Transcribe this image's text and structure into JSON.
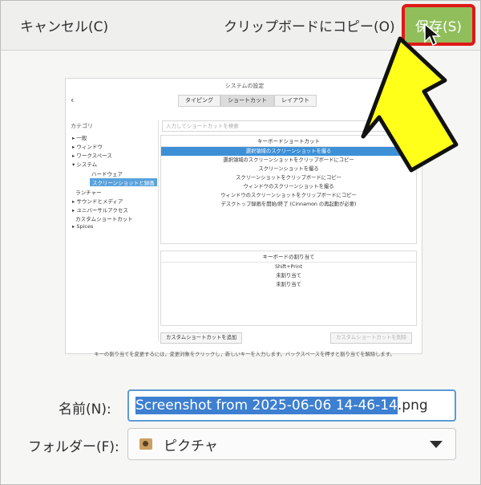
{
  "header": {
    "cancel_label": "キャンセル(C)",
    "copy_label": "クリップボードにコピー(O)",
    "save_label": "保存(S)"
  },
  "preview": {
    "window_title": "システムの設定",
    "tabs": [
      "タイピング",
      "ショートカット",
      "レイアウト"
    ],
    "sidebar_header": "カテゴリ",
    "sidebar_items": [
      "一般",
      "ウィンドウ",
      "ワークスペース",
      "システム",
      "ハードウェア",
      "スクリーンショットと録画",
      "ランチャー",
      "サウンドとメディア",
      "ユニバーサルアクセス",
      "カスタムショートカット",
      "Spices"
    ],
    "search_placeholder": "入力してショートカットを検索",
    "keyboard_shortcuts_header": "キーボードショートカット",
    "shortcuts": [
      "選択領域のスクリーンショットを撮る",
      "選択領域のスクリーンショットをクリップボードにコピー",
      "スクリーンショットを撮る",
      "スクリーンショットをクリップボードにコピー",
      "ウィンドウのスクリーンショットを撮る",
      "ウィンドウのスクリーンショットをクリップボードにコピー",
      "デスクトップ録画を開始/終了 (Cinnamon の再起動が必要)"
    ],
    "assignment_header": "キーボードの割り当て",
    "assignments": [
      "Shift+Print",
      "未割り当て",
      "未割り当て"
    ],
    "add_custom_button": "カスタムショートカットを追加",
    "remove_custom_button": "カスタムショートカットを削除",
    "footer_hint": "キーの割り当てを変更するには，変更対象をクリックし，新しいキーを入力します。バックスペースを押すと割り当てを解除します。"
  },
  "form": {
    "name_label": "名前(N):",
    "name_value_selected": "Screenshot from 2025-06-06 14-46-14",
    "name_value_ext": ".png",
    "folder_label": "フォルダー(F):",
    "folder_value": "ピクチャ"
  },
  "colors": {
    "save_bg": "#8fbe5a",
    "highlight_border": "#e01818",
    "arrow_fill": "#ffff1a",
    "selection": "#3d7fd0"
  }
}
